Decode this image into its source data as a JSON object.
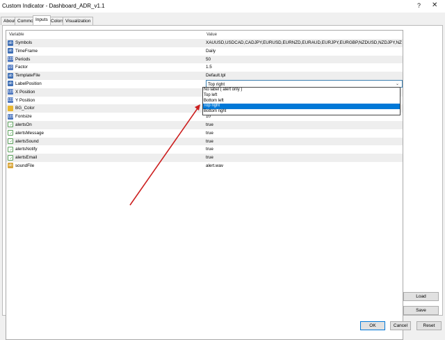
{
  "window": {
    "title": "Custom Indicator - Dashboard_ADR_v1.1",
    "help_label": "?",
    "close_label": "✕"
  },
  "tabs": [
    {
      "label": "About"
    },
    {
      "label": "Common"
    },
    {
      "label": "Inputs"
    },
    {
      "label": "Colors"
    },
    {
      "label": "Visualization"
    }
  ],
  "grid": {
    "headers": {
      "variable": "Variable",
      "value": "Value"
    },
    "rows": [
      {
        "icon": "list-icon",
        "icon_text": "ab",
        "name": "Symbols",
        "value": "XAUUSD,USDCAD,CADJPY,EURUSD,EURNZD,EURAUD,EURJPY,EURGBP,NZDUSD,NZDJPY,NZDCAD,AUDU..."
      },
      {
        "icon": "list-icon",
        "icon_text": "ab",
        "name": "TimeFrame",
        "value": "Daily"
      },
      {
        "icon": "number-icon",
        "icon_text": "123",
        "name": "Periods",
        "value": "50"
      },
      {
        "icon": "number-icon",
        "icon_text": "1/2",
        "name": "Factor",
        "value": "1.5"
      },
      {
        "icon": "list-icon",
        "icon_text": "ab",
        "name": "TemplateFile",
        "value": "Default.tpl"
      },
      {
        "icon": "list-icon",
        "icon_text": "ab",
        "name": "LabelPosition",
        "value": "Top right"
      },
      {
        "icon": "number-icon",
        "icon_text": "123",
        "name": "X Position",
        "value": ""
      },
      {
        "icon": "number-icon",
        "icon_text": "123",
        "name": "Y Position",
        "value": ""
      },
      {
        "icon": "color-icon",
        "icon_text": "",
        "name": "BG_Color",
        "value": ""
      },
      {
        "icon": "number-icon",
        "icon_text": "123",
        "name": "Fontsize",
        "value": "10"
      },
      {
        "icon": "bool-icon",
        "icon_text": "✓",
        "name": "alertsOn",
        "value": "true"
      },
      {
        "icon": "bool-icon",
        "icon_text": "✓",
        "name": "alertsMessage",
        "value": "true"
      },
      {
        "icon": "bool-icon",
        "icon_text": "✓",
        "name": "alertsSound",
        "value": "true"
      },
      {
        "icon": "bool-icon",
        "icon_text": "✓",
        "name": "alertsNotify",
        "value": "true"
      },
      {
        "icon": "bool-icon",
        "icon_text": "✓",
        "name": "alertsEmail",
        "value": "true"
      },
      {
        "icon": "file-icon",
        "icon_text": "ab",
        "name": "soundFile",
        "value": "alert.wav"
      }
    ]
  },
  "dropdown": {
    "arrow": "⌄",
    "options": [
      {
        "label": "No label ( alert only )"
      },
      {
        "label": "Top left"
      },
      {
        "label": "Bottom left"
      },
      {
        "label": "Top right"
      },
      {
        "label": "Bottom right"
      }
    ]
  },
  "side_buttons": {
    "load": "Load",
    "save": "Save"
  },
  "footer_buttons": {
    "ok": "OK",
    "cancel": "Cancel",
    "reset": "Reset"
  },
  "colors": {
    "accent": "#0078d7",
    "arrow": "#cc1f1f"
  }
}
